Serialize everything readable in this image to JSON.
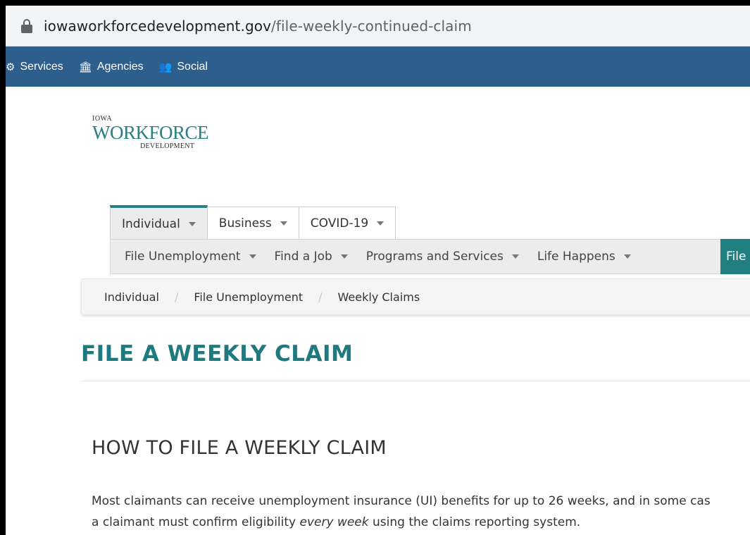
{
  "browser": {
    "url_domain": "iowaworkforcedevelopment.gov",
    "url_path": "/file-weekly-continued-claim"
  },
  "utility_nav": {
    "items": [
      {
        "label": "Services",
        "icon": "gears-icon"
      },
      {
        "label": "Agencies",
        "icon": "building-columns-icon"
      },
      {
        "label": "Social",
        "icon": "users-icon"
      }
    ]
  },
  "logo": {
    "line1": "IOWA",
    "line2": "WORKFORCE",
    "line3": "DEVELOPMENT"
  },
  "primary_tabs": [
    {
      "label": "Individual",
      "active": true
    },
    {
      "label": "Business",
      "active": false
    },
    {
      "label": "COVID-19",
      "active": false
    }
  ],
  "sub_nav": {
    "items": [
      {
        "label": "File Unemployment"
      },
      {
        "label": "Find a Job"
      },
      {
        "label": "Programs and Services"
      },
      {
        "label": "Life Happens"
      }
    ],
    "highlight_label": "File"
  },
  "breadcrumb": [
    "Individual",
    "File Unemployment",
    "Weekly Claims"
  ],
  "page_title": "FILE A WEEKLY CLAIM",
  "section_title": "HOW TO FILE A WEEKLY CLAIM",
  "paragraph": {
    "line1": "Most claimants can receive unemployment insurance (UI) benefits for up to 26 weeks, and in some cas",
    "line2_before": "a claimant must confirm eligibility ",
    "line2_em": "every week",
    "line2_after": " using the claims reporting system."
  },
  "colors": {
    "teal": "#1f7a80",
    "nav_blue": "#2e5f8c",
    "tab_gray": "#ececec"
  }
}
